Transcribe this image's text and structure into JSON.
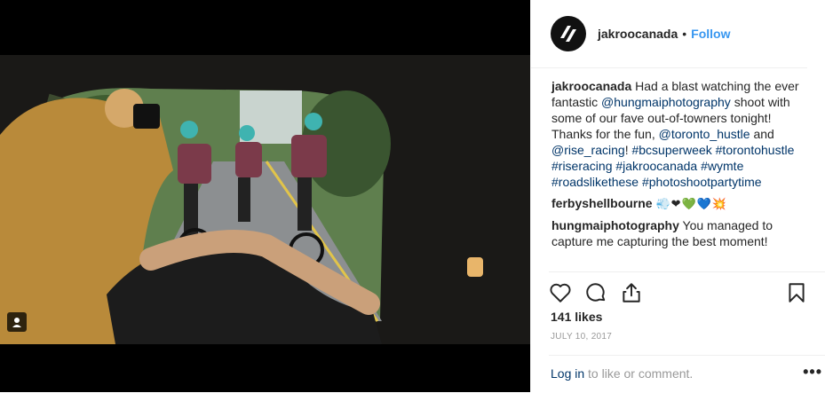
{
  "post": {
    "username": "jakroocanada",
    "follow_label": "Follow",
    "dot": "•",
    "caption": {
      "user": "jakroocanada",
      "t1": "Had a blast watching the ever fantastic",
      "mention1": "@hungmaiphotography",
      "t2": "shoot with some of our fave out-of-towners tonight! Thanks for the fun,",
      "mention2": "@toronto_hustle",
      "t3": "and",
      "mention3": "@rise_racing",
      "t4": "!",
      "hashtags": [
        "#bcsuperweek",
        "#torontohustle",
        "#riseracing",
        "#jakroocanada",
        "#wymte",
        "#roadslikethese",
        "#photoshootpartytime"
      ]
    },
    "comments": [
      {
        "user": "ferbyshellbourne",
        "text": "💨❤💚💙💥"
      },
      {
        "user": "hungmaiphotography",
        "text": "You managed to capture me capturing the best moment!"
      }
    ],
    "likes": "141 likes",
    "date": "JULY 10, 2017",
    "login_link": "Log in",
    "login_rest": "to like or comment.",
    "more": "•••"
  },
  "icons": [
    "user-tag-icon",
    "heart-icon",
    "comment-icon",
    "share-icon",
    "bookmark-icon",
    "brand-logo-icon"
  ],
  "colors": {
    "link": "#003569",
    "follow": "#3897f0",
    "muted": "#999999"
  }
}
